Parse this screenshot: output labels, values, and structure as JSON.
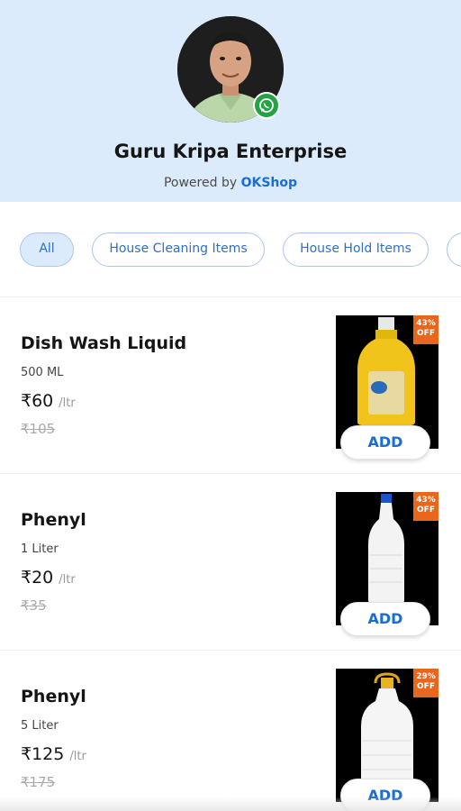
{
  "header": {
    "shop_name": "Guru Kripa Enterprise",
    "powered_prefix": "Powered by",
    "powered_brand": "OKShop"
  },
  "categories": [
    {
      "label": "All",
      "active": true
    },
    {
      "label": "House Cleaning Items",
      "active": false
    },
    {
      "label": "House Hold Items",
      "active": false
    }
  ],
  "items": [
    {
      "name": "Dish Wash Liquid",
      "qty": "500 ML",
      "price": "₹60",
      "unit": "/ltr",
      "mrp": "₹105",
      "discount_line1": "43%",
      "discount_line2": "OFF",
      "add_label": "ADD",
      "product_icon": "yellow-bottle-icon"
    },
    {
      "name": "Phenyl",
      "qty": "1 Liter",
      "price": "₹20",
      "unit": "/ltr",
      "mrp": "₹35",
      "discount_line1": "43%",
      "discount_line2": "OFF",
      "add_label": "ADD",
      "product_icon": "white-bottle-icon"
    },
    {
      "name": "Phenyl",
      "qty": "5 Liter",
      "price": "₹125",
      "unit": "/ltr",
      "mrp": "₹175",
      "discount_line1": "29%",
      "discount_line2": "OFF",
      "add_label": "ADD",
      "product_icon": "white-can-icon"
    }
  ],
  "colors": {
    "header_bg": "#dcebfc",
    "accent": "#1a6cd6",
    "discount_badge": "#e8671c",
    "whatsapp": "#25a244"
  }
}
